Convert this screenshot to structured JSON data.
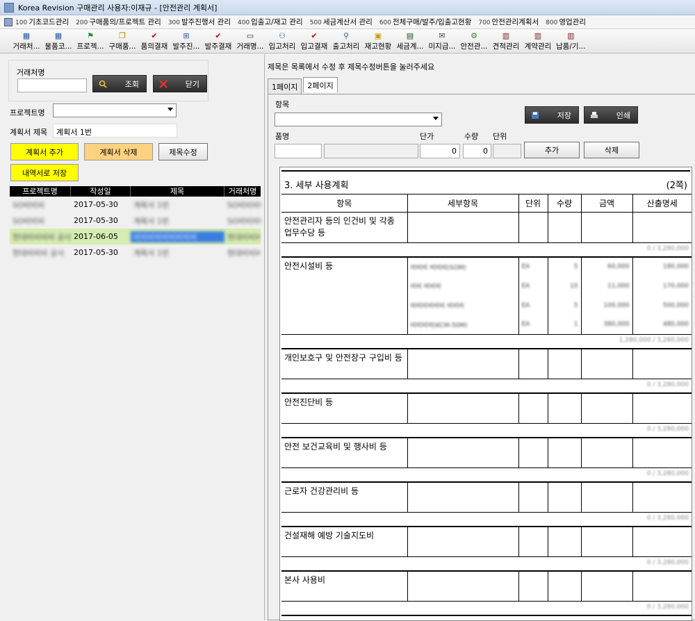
{
  "window": {
    "title": "Korea Revision 구매관리 사용자:이재규 - [안전관리 계획서]"
  },
  "menu": [
    {
      "num": "100",
      "label": "기초코드관리"
    },
    {
      "num": "200",
      "label": "구매품의/프로젝트 관리"
    },
    {
      "num": "300",
      "label": "발주진행서 관리"
    },
    {
      "num": "400",
      "label": "입출고/재고 관리"
    },
    {
      "num": "500",
      "label": "세금계산서 관리"
    },
    {
      "num": "600",
      "label": "전체구매/발주/입출고현황"
    },
    {
      "num": "700",
      "label": "안전관리계획서"
    },
    {
      "num": "800",
      "label": "영업관리"
    }
  ],
  "toolbar": [
    {
      "label": "거래처...",
      "icon": "grid-icon",
      "glyph": "▦",
      "color": "#2a5ba0"
    },
    {
      "label": "물품코...",
      "icon": "grid-icon",
      "glyph": "▦",
      "color": "#2a5ba0"
    },
    {
      "label": "프로젝...",
      "icon": "flag-icon",
      "glyph": "⚑",
      "color": "#2a8a2a"
    },
    {
      "label": "구매품...",
      "icon": "document-icon",
      "glyph": "❐",
      "color": "#b08000"
    },
    {
      "label": "품의결재",
      "icon": "check-icon",
      "glyph": "✔",
      "color": "#d00000"
    },
    {
      "label": "발주진...",
      "icon": "calculator-icon",
      "glyph": "⊞",
      "color": "#2a5ba0"
    },
    {
      "label": "발주결재",
      "icon": "check-icon",
      "glyph": "✔",
      "color": "#d00000"
    },
    {
      "label": "거래명...",
      "icon": "window-icon",
      "glyph": "▭",
      "color": "#333333"
    },
    {
      "label": "입고처리",
      "icon": "users-icon",
      "glyph": "⚇",
      "color": "#2a5ba0"
    },
    {
      "label": "입고결재",
      "icon": "check-icon",
      "glyph": "✔",
      "color": "#d00000"
    },
    {
      "label": "출고처리",
      "icon": "network-icon",
      "glyph": "⚲",
      "color": "#2a5ba0"
    },
    {
      "label": "재고현황",
      "icon": "box-icon",
      "glyph": "▣",
      "color": "#c8a000"
    },
    {
      "label": "세금계...",
      "icon": "book-icon",
      "glyph": "▤",
      "color": "#205020"
    },
    {
      "label": "미지급...",
      "icon": "envelope-icon",
      "glyph": "✉",
      "color": "#444444"
    },
    {
      "label": "안전관...",
      "icon": "gear-icon",
      "glyph": "⚙",
      "color": "#2a8a2a"
    },
    {
      "label": "견적관리",
      "icon": "book-icon",
      "glyph": "▥",
      "color": "#7a2020"
    },
    {
      "label": "계약관리",
      "icon": "book-icon",
      "glyph": "▥",
      "color": "#7a2020"
    },
    {
      "label": "납품/기...",
      "icon": "book-icon",
      "glyph": "▥",
      "color": "#7a2020"
    }
  ],
  "left": {
    "client_label": "거래처명",
    "client_value": "",
    "search_label": "조회",
    "close_label": "닫기",
    "project_label": "프로젝트명",
    "project_value": "",
    "plan_title_label": "계획서 제목",
    "plan_title_value": "계획서 1번",
    "add_plan_label": "계획서 추가",
    "delete_plan_label": "계획서 삭제",
    "edit_title_label": "제목수정",
    "save_as_label": "내역서로 저장",
    "columns": [
      "프로젝트명",
      "작성일",
      "제목",
      "거래처명"
    ],
    "rows": [
      {
        "project": "SO비비비",
        "date": "2017-05-30",
        "title": "계획서 1번",
        "client": "SO비비비비비"
      },
      {
        "project": "SO비비비",
        "date": "2017-05-30",
        "title": "계획서 1번",
        "client": "SO비비비비"
      },
      {
        "project": "현대비비비비 공사",
        "date": "2017-06-05",
        "title": "비비비비비비비비비",
        "client": "현대비비비비"
      },
      {
        "project": "현대비비비 공사",
        "date": "2017-05-30",
        "title": "계획서 1번",
        "client": "현대비비비비"
      }
    ]
  },
  "right": {
    "hint": "제목은 목록에서 수정 후 제목수정버튼을 눌러주세요",
    "tabs": [
      "1페이지",
      "2페이지"
    ],
    "item_label": "항목",
    "item_value": "",
    "save_label": "저장",
    "print_label": "인쇄",
    "product_label": "품명",
    "unit_price_label": "단가",
    "qty_label": "수량",
    "unit_label": "단위",
    "unit_price_value": "0",
    "qty_value": "0",
    "add_label": "추가",
    "delete_label": "삭제",
    "doc": {
      "section_title": "3. 세부 사용계획",
      "page_label": "(2쪽)",
      "headers": [
        "항목",
        "세부항목",
        "단위",
        "수량",
        "금액",
        "산출명세"
      ],
      "categories": [
        {
          "name": "안전관리자 등의 인건비 및 각종 업무수당 등",
          "sum": "0 / 3,280,000",
          "items": []
        },
        {
          "name": "안전시설비 등",
          "sum": "1,280,000 / 3,280,000",
          "items": [
            {
              "detail": "비비비 비비비(SOM)",
              "unit": "EA",
              "qty": "5",
              "amount": "60,000",
              "spec": "180,000"
            },
            {
              "detail": "비비 비비비",
              "unit": "EA",
              "qty": "10",
              "amount": "11,000",
              "spec": "170,000"
            },
            {
              "detail": "비비비비비비 비비비",
              "unit": "EA",
              "qty": "5",
              "amount": "100,000",
              "spec": "500,000"
            },
            {
              "detail": "비비비비(KCM-50M)",
              "unit": "EA",
              "qty": "1",
              "amount": "380,000",
              "spec": "480,000"
            }
          ]
        },
        {
          "name": "개인보호구 및 안전장구 구입비 등",
          "sum": "0 / 3,280,000",
          "items": []
        },
        {
          "name": "안전진단비 등",
          "sum": "0 / 3,280,000",
          "items": []
        },
        {
          "name": "안전 보건교육비 및 행사비 등",
          "sum": "0 / 3,280,000",
          "items": []
        },
        {
          "name": "근로자 건강관리비 등",
          "sum": "0 / 3,280,000",
          "items": []
        },
        {
          "name": "건설재해 예방 기술지도비",
          "sum": "0 / 3,280,000",
          "items": []
        },
        {
          "name": "본사 사용비",
          "sum": "0 / 3,280,000",
          "items": []
        }
      ]
    }
  }
}
